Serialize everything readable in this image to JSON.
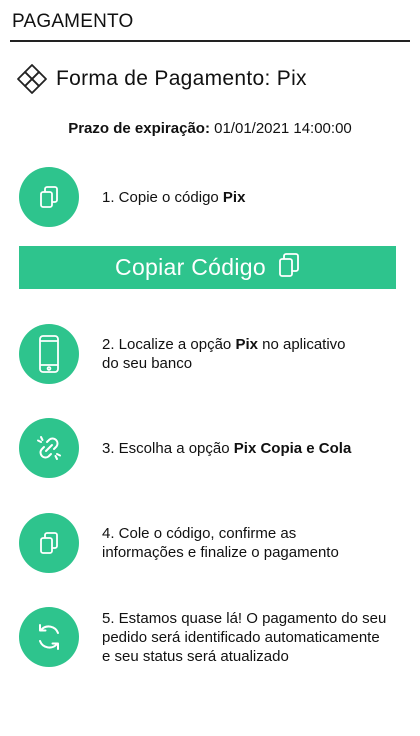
{
  "header": {
    "title": "PAGAMENTO"
  },
  "payment_method": {
    "icon": "pix-icon",
    "title": "Forma de Pagamento: Pix"
  },
  "expiration": {
    "label": "Prazo de expiração:",
    "value": "01/01/2021 14:00:00"
  },
  "copy_button": {
    "label": "Copiar Código",
    "icon": "copy-icon"
  },
  "steps": [
    {
      "icon": "copy-icon",
      "parts": [
        "1. Copie o código ",
        "Pix",
        ""
      ]
    },
    {
      "icon": "phone-icon",
      "parts": [
        "2. Localize a opção ",
        "Pix",
        " no aplicativo",
        "do seu banco"
      ]
    },
    {
      "icon": "broken-link-icon",
      "parts": [
        "3. Escolha a opção ",
        "Pix Copia e Cola"
      ]
    },
    {
      "icon": "copy-icon",
      "lines": [
        "4. Cole o código, confirme as",
        "informações e finalize o pagamento"
      ]
    },
    {
      "icon": "refresh-icon",
      "lines": [
        "5. Estamos quase lá! O pagamento do seu",
        "pedido será identificado automaticamente",
        "e seu status será atualizado"
      ]
    }
  ],
  "colors": {
    "accent": "#2ec48d",
    "text": "#111111"
  }
}
